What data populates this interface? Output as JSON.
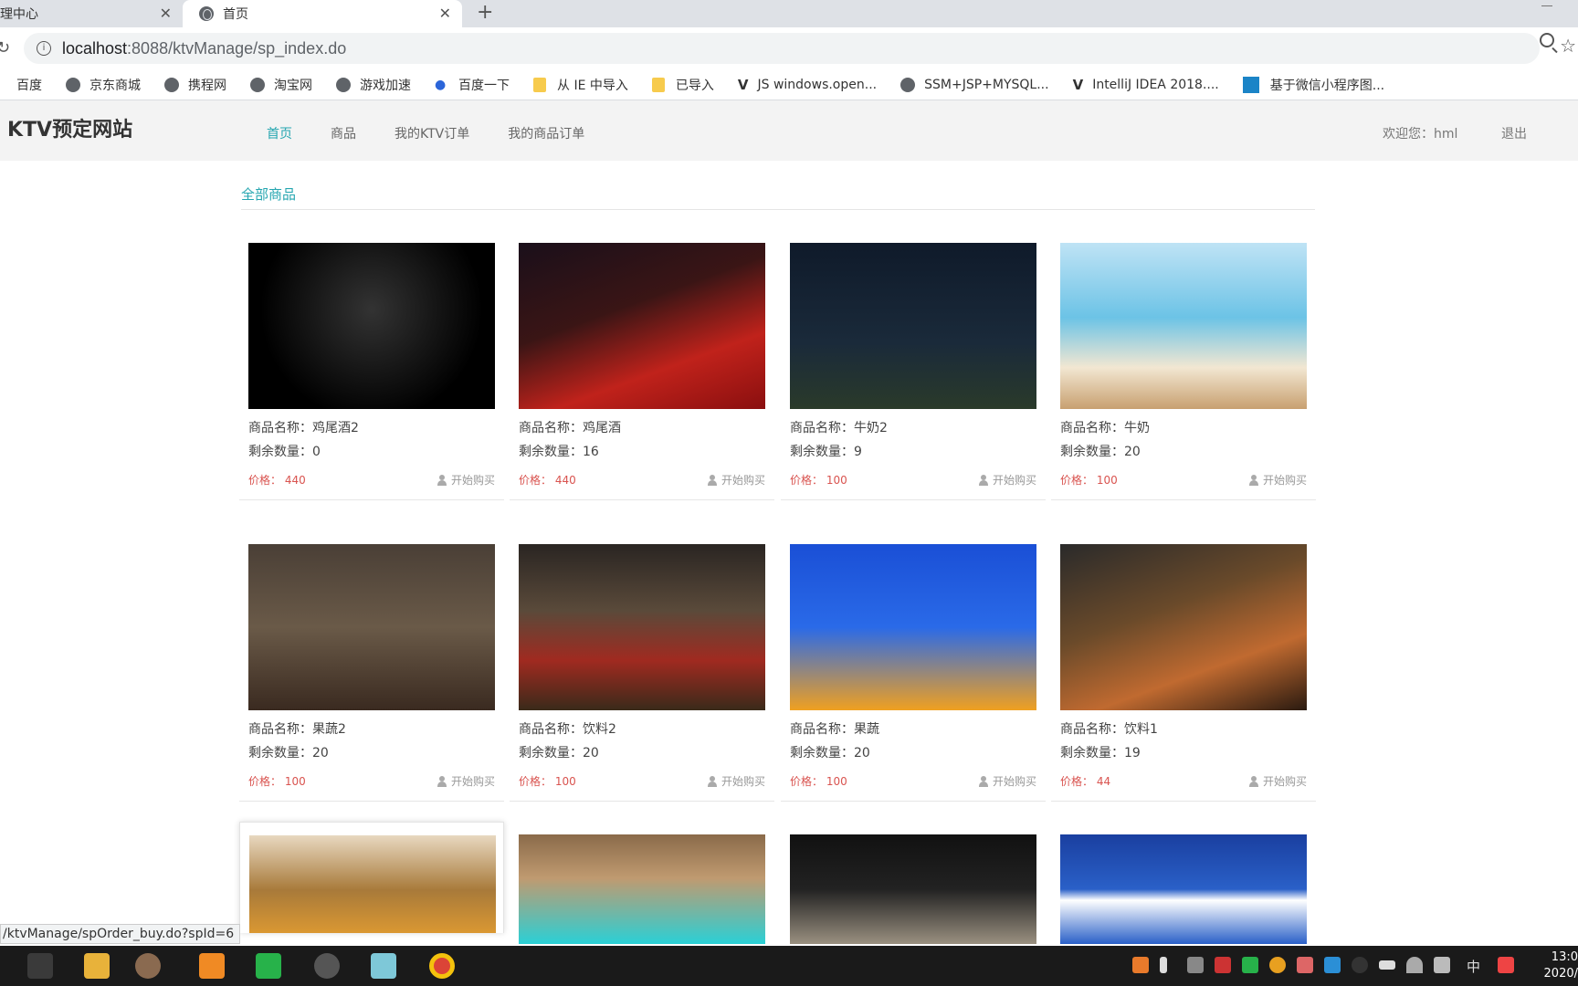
{
  "browser": {
    "tabs": [
      {
        "label": "理中心",
        "active": false
      },
      {
        "label": "首页",
        "active": true
      }
    ],
    "new_tab": "+",
    "url_host": "localhost",
    "url_path": ":8088/ktvManage/sp_index.do",
    "bookmarks": [
      {
        "label": "百度",
        "icon": "globe-icon"
      },
      {
        "label": "京东商城",
        "icon": "globe-icon"
      },
      {
        "label": "携程网",
        "icon": "globe-icon"
      },
      {
        "label": "淘宝网",
        "icon": "globe-icon"
      },
      {
        "label": "游戏加速",
        "icon": "globe-icon"
      },
      {
        "label": "百度一下",
        "icon": "paw-icon"
      },
      {
        "label": "从 IE 中导入",
        "icon": "folder-icon"
      },
      {
        "label": "已导入",
        "icon": "folder-icon"
      },
      {
        "label": "JS windows.open...",
        "icon": "vl-icon"
      },
      {
        "label": "SSM+JSP+MYSQL...",
        "icon": "globe-icon"
      },
      {
        "label": "IntelliJ IDEA 2018....",
        "icon": "vl-icon"
      },
      {
        "label": "基于微信小程序图...",
        "icon": "blue-square-icon"
      }
    ]
  },
  "site": {
    "brand": "KTV预定网站",
    "nav": [
      {
        "label": "首页",
        "active": true
      },
      {
        "label": "商品",
        "active": false
      },
      {
        "label": "我的KTV订单",
        "active": false
      },
      {
        "label": "我的商品订单",
        "active": false
      }
    ],
    "welcome": "欢迎您：hml",
    "logout": "退出",
    "section_title": "全部商品",
    "name_prefix": "商品名称：",
    "qty_prefix": "剩余数量：",
    "price_prefix": "价格：",
    "buy_label": "开始购买"
  },
  "products": [
    {
      "name": "鸡尾酒2",
      "qty": "0",
      "price": "440"
    },
    {
      "name": "鸡尾酒",
      "qty": "16",
      "price": "440"
    },
    {
      "name": "牛奶2",
      "qty": "9",
      "price": "100"
    },
    {
      "name": "牛奶",
      "qty": "20",
      "price": "100"
    },
    {
      "name": "果蔬2",
      "qty": "20",
      "price": "100"
    },
    {
      "name": "饮料2",
      "qty": "20",
      "price": "100"
    },
    {
      "name": "果蔬",
      "qty": "20",
      "price": "100"
    },
    {
      "name": "饮料1",
      "qty": "19",
      "price": "44"
    },
    {
      "name": "",
      "qty": "",
      "price": ""
    },
    {
      "name": "",
      "qty": "",
      "price": ""
    },
    {
      "name": "",
      "qty": "",
      "price": ""
    },
    {
      "name": "",
      "qty": "",
      "price": ""
    }
  ],
  "status_url": "/ktvManage/spOrder_buy.do?spId=6",
  "taskbar": {
    "ime": "中",
    "clock_time": "13:0",
    "clock_date": "2020/"
  },
  "colors": {
    "accent": "#26a6b0",
    "price": "#d9534f"
  }
}
